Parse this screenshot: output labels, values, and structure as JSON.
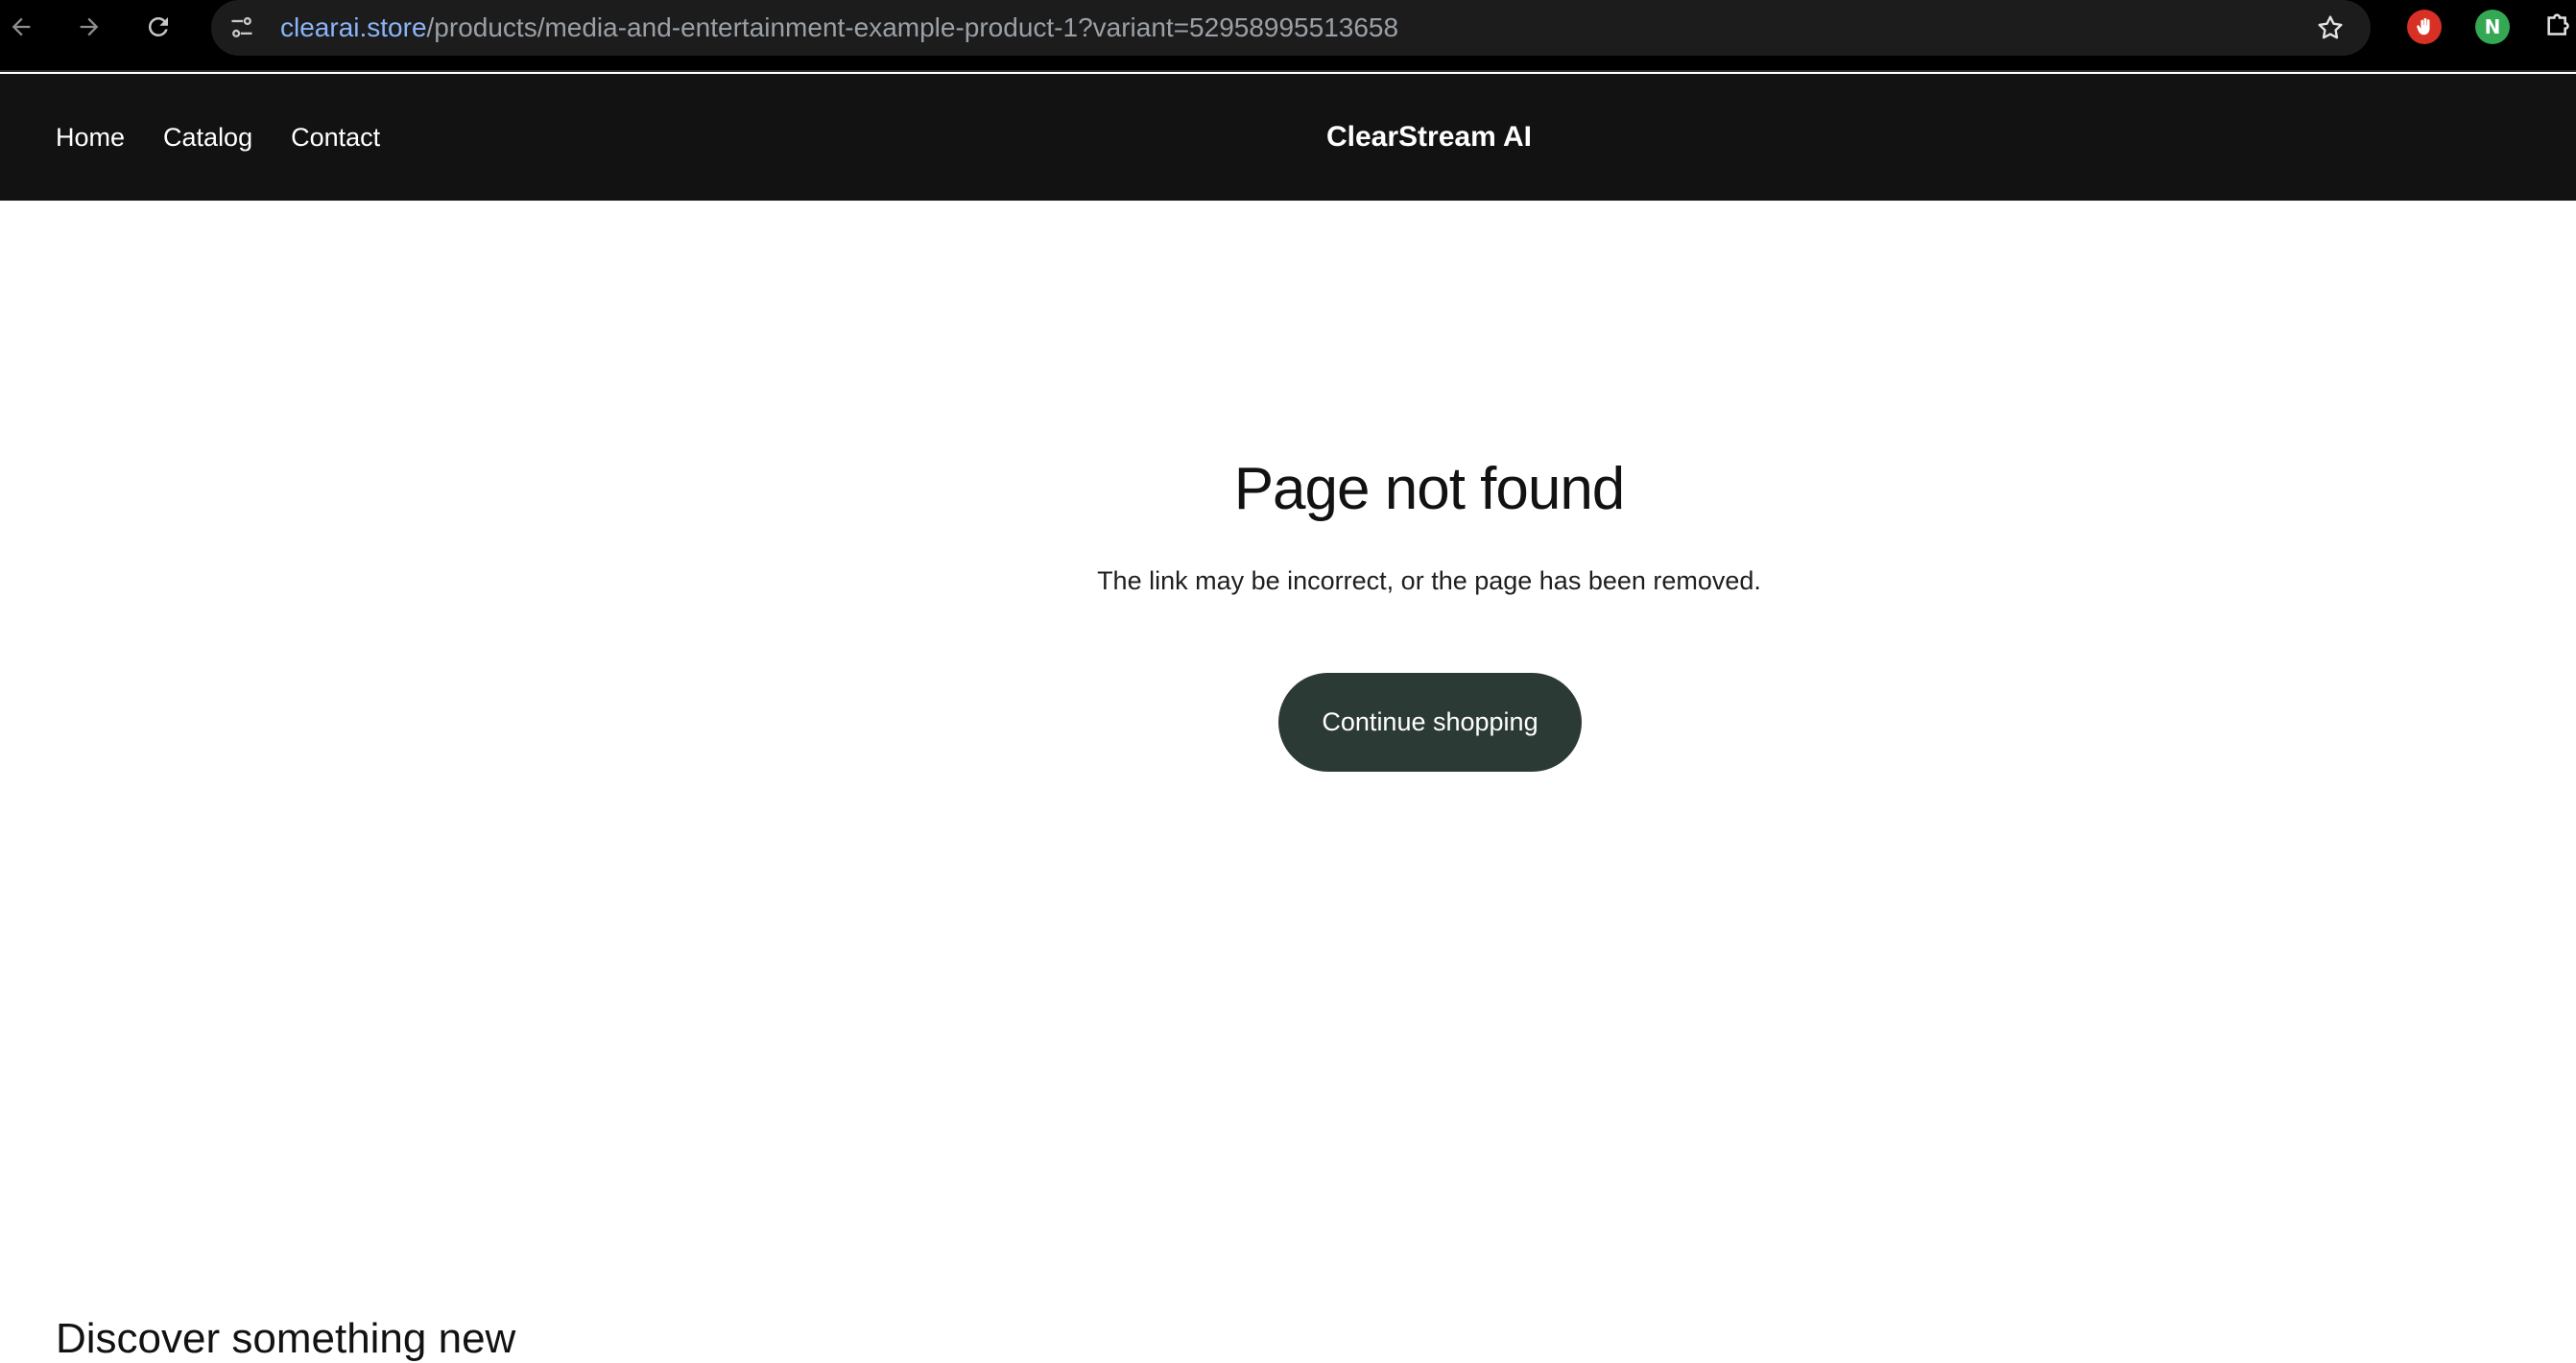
{
  "browser": {
    "url_host": "clearai.store",
    "url_path": "/products/media-and-entertainment-example-product-1?variant=52958995513658",
    "extensions": {
      "green_letter": "N"
    },
    "colors": {
      "url_host": "#8ab4f8",
      "url_path": "#9aa0a6",
      "ext_red": "#d93025",
      "ext_green": "#34a853"
    }
  },
  "header": {
    "nav": {
      "home": "Home",
      "catalog": "Catalog",
      "contact": "Contact"
    },
    "brand": "ClearStream AI"
  },
  "main": {
    "title": "Page not found",
    "subtitle": "The link may be incorrect, or the page has been removed.",
    "continue_label": "Continue shopping",
    "discover_heading": "Discover something new"
  },
  "colors": {
    "header_bg": "#121212",
    "button_bg": "#2c3a35"
  }
}
